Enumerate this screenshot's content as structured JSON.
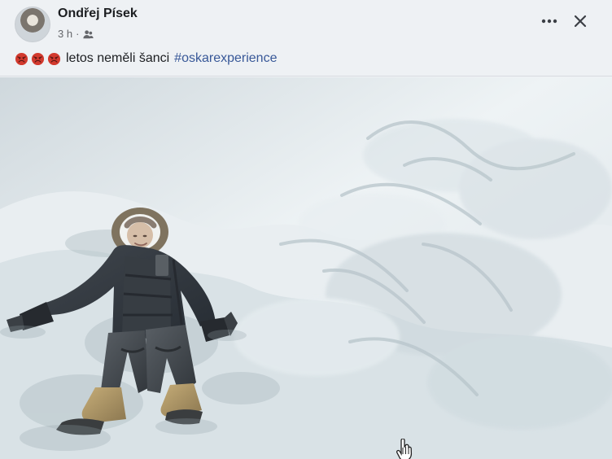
{
  "post": {
    "author": "Ondřej Písek",
    "time": "3 h",
    "separator": "·",
    "audience_icon": "friends-icon",
    "caption_text": "letos neměli šanci",
    "hashtag": "#oskarexperience",
    "caption_emoji": [
      "red-emoji",
      "red-emoji",
      "red-emoji"
    ]
  },
  "header_actions": {
    "more_icon": "more-icon",
    "close_icon": "close-icon"
  },
  "photo": {
    "subject": "child-in-snow-angel",
    "cursor_icon": "hand-cursor-icon"
  }
}
